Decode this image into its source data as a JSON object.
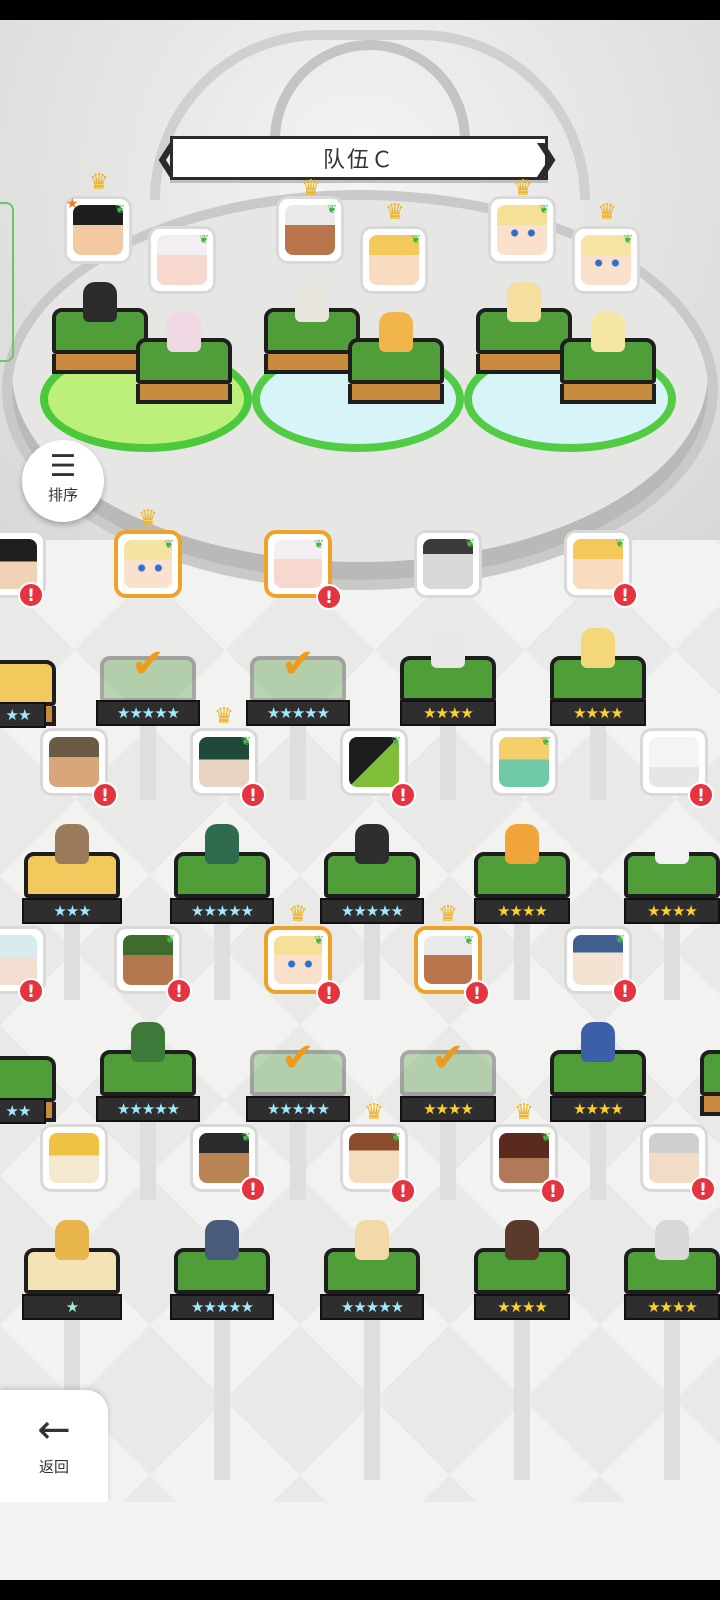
{
  "team": {
    "title": "队伍Ｃ",
    "prev_icon": "chevron-left-icon",
    "next_icon": "chevron-right-icon"
  },
  "sort": {
    "label": "排序",
    "icon": "sort-icon"
  },
  "back": {
    "label": "返回",
    "icon": "arrow-left-icon"
  },
  "badges": {
    "alert": "!",
    "check": "✔",
    "crown": "♛",
    "leaf": "❦",
    "star": "★"
  },
  "colors": {
    "selected_border": "#f0a12a",
    "alert": "#e53340",
    "pedestal_green": "#4f9e3a",
    "stars_gold": "#ffd02a"
  },
  "team_slots": [
    {
      "heroes": 2,
      "base": "green"
    },
    {
      "heroes": 2,
      "base": "blue"
    },
    {
      "heroes": 2,
      "base": "blue"
    }
  ],
  "roster": {
    "row1": [
      "★★★★★",
      "★★★★★",
      "★★★★★",
      "★★★★",
      "★★★★"
    ],
    "row2": [
      "★★★",
      "★★★★★",
      "★★★★★",
      "★★★★",
      "★★★★"
    ],
    "row3": [
      "★★★★★",
      "★★★★★",
      "★★★★",
      "★★★★"
    ],
    "row4": [
      "★",
      "★★★★★",
      "★★★★★",
      "★★★★",
      "★★★★"
    ],
    "edge": "★★"
  }
}
